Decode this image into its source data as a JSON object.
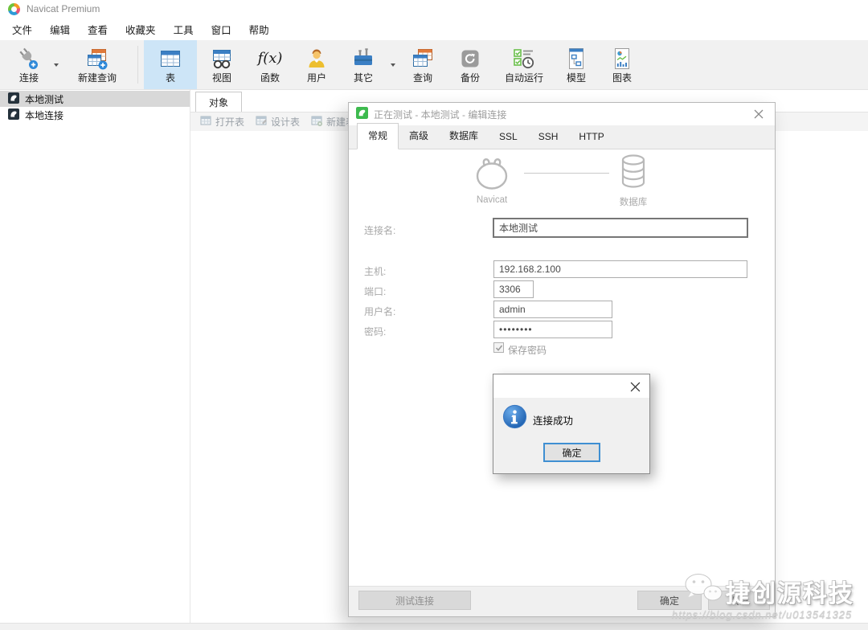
{
  "app": {
    "title": "Navicat Premium"
  },
  "menu_bar": {
    "items": [
      {
        "label": "文件"
      },
      {
        "label": "编辑"
      },
      {
        "label": "查看"
      },
      {
        "label": "收藏夹"
      },
      {
        "label": "工具"
      },
      {
        "label": "窗口"
      },
      {
        "label": "帮助"
      }
    ]
  },
  "toolbar": {
    "buttons": [
      {
        "label": "连接",
        "has_dropdown": true
      },
      {
        "label": "新建查询"
      },
      {
        "label": "表",
        "active": true
      },
      {
        "label": "视图"
      },
      {
        "label": "函数",
        "icon_text": "f(x)"
      },
      {
        "label": "用户"
      },
      {
        "label": "其它",
        "has_dropdown": true
      },
      {
        "label": "查询"
      },
      {
        "label": "备份"
      },
      {
        "label": "自动运行"
      },
      {
        "label": "模型"
      },
      {
        "label": "图表"
      }
    ]
  },
  "sidebar": {
    "connections": [
      {
        "label": "本地测试",
        "selected": true
      },
      {
        "label": "本地连接",
        "selected": false
      }
    ]
  },
  "workspace": {
    "tab_label": "对象",
    "toolbar": {
      "open_table": "打开表",
      "design_table": "设计表",
      "new_table": "新建表"
    }
  },
  "dialog": {
    "title": "正在测试 - 本地测试 - 编辑连接",
    "tabs": [
      {
        "label": "常规",
        "active": true
      },
      {
        "label": "高级",
        "active": false
      },
      {
        "label": "数据库",
        "active": false
      },
      {
        "label": "SSL",
        "active": false
      },
      {
        "label": "SSH",
        "active": false
      },
      {
        "label": "HTTP",
        "active": false
      }
    ],
    "diagram": {
      "source_label": "Navicat",
      "target_label": "数据库"
    },
    "form": {
      "connection_name": {
        "label": "连接名:",
        "value": "本地测试"
      },
      "host": {
        "label": "主机:",
        "value": "192.168.2.100"
      },
      "port": {
        "label": "端口:",
        "value": "3306"
      },
      "username": {
        "label": "用户名:",
        "value": "admin"
      },
      "password": {
        "label": "密码:",
        "value": "••••••••"
      },
      "save_password": {
        "label": "保存密码",
        "checked": true
      }
    },
    "footer": {
      "test_button": "测试连接",
      "ok_button": "确定",
      "cancel_button": "取消"
    }
  },
  "messagebox": {
    "message": "连接成功",
    "ok_button": "确定"
  },
  "watermark": {
    "brand": "捷创源科技",
    "url": "https://blog.csdn.net/u013541325"
  },
  "colors": {
    "accent_blue": "#2f89d8",
    "toolbar_active_bg": "#cde5f7",
    "sidebar_selected_bg": "#d8d8d8",
    "dialog_icon_green": "#3dba4e",
    "info_icon_blue": "#1f5fbf",
    "focus_border_blue": "#3f8fd2"
  }
}
